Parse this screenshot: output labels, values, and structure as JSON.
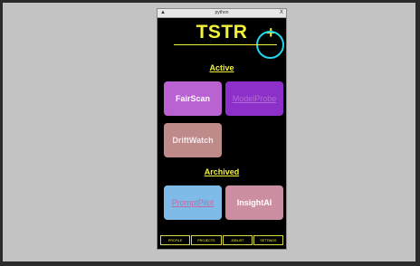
{
  "window": {
    "title": "python",
    "close_glyph": "X",
    "left_glyph": "▲"
  },
  "app": {
    "title": "TSTR",
    "add_label": "+"
  },
  "sections": {
    "active": "Active",
    "archived": "Archived"
  },
  "active_tiles": [
    {
      "label": "FairScan",
      "bg": "#bb62d3",
      "color": "#ffffff",
      "link": false
    },
    {
      "label": "ModelProbe",
      "bg": "#8d2fc9",
      "color": "#b26ad3",
      "link": true
    },
    {
      "label": "DriftWatch",
      "bg": "#bf8a8a",
      "color": "#f3e9e9",
      "link": false
    }
  ],
  "archived_tiles": [
    {
      "label": "PromptPilot",
      "bg": "#7fbbe8",
      "color": "#c46aa1",
      "link": true
    },
    {
      "label": "InsightAI",
      "bg": "#cc8fa1",
      "color": "#ffffff",
      "link": false
    }
  ],
  "nav": [
    "PROFILE",
    "PROJECTS",
    "JOBLIST",
    "SETTINGS"
  ],
  "colors": {
    "accent": "#f2f23a",
    "highlight_ring": "#1fd7e8"
  }
}
